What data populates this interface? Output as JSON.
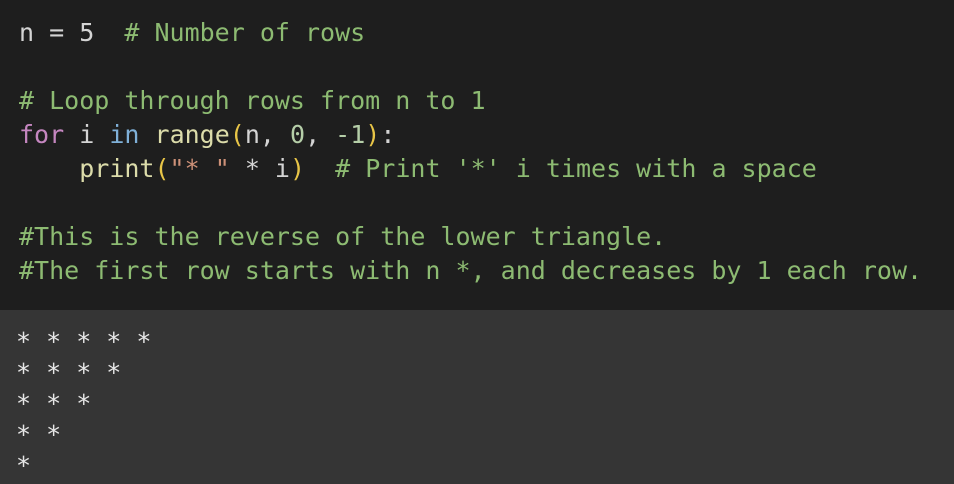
{
  "code": {
    "line1": {
      "code": "n = 5",
      "comment": "# Number of rows"
    },
    "line3": {
      "comment": "# Loop through rows from n to 1"
    },
    "line4": {
      "kw_for": "for",
      "var_i": "i",
      "kw_in": "in",
      "func_range": "range",
      "paren_open": "(",
      "args_a": "n, ",
      "num_0": "0",
      "args_b": ", ",
      "num_neg1": "-1",
      "paren_close": ")",
      "colon": ":"
    },
    "line5": {
      "indent": "    ",
      "func_print": "print",
      "paren_open": "(",
      "string": "\"* \"",
      "expr": " * i",
      "paren_close": ")",
      "comment": "# Print '*' i times with a space"
    },
    "line7": {
      "comment": "#This is the reverse of the lower triangle."
    },
    "line8": {
      "comment": "#The first row starts with n *, and decreases by 1 each row."
    }
  },
  "output": {
    "lines": [
      "* * * * *",
      "* * * *",
      "* * *",
      "* *",
      "*"
    ]
  },
  "colors": {
    "editor_bg": "#1e1e1e",
    "output_bg": "#353535",
    "comment": "#8dbb72",
    "keyword": "#c586c0",
    "keyword_in": "#7fb0d8",
    "function": "#dcdcaa",
    "paren": "#e8c547",
    "string": "#ce9178"
  }
}
